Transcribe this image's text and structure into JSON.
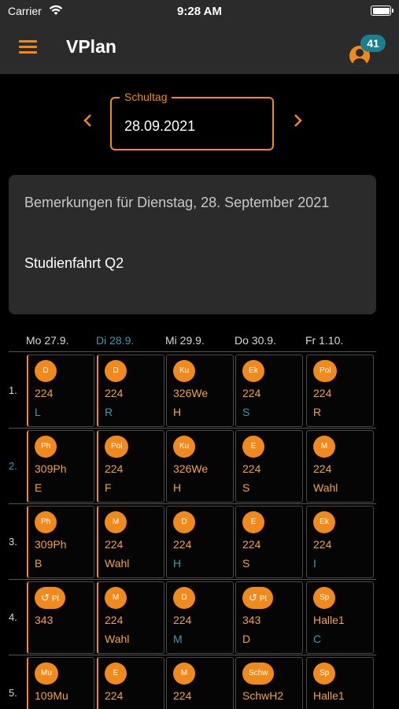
{
  "status": {
    "carrier": "Carrier",
    "time": "9:28 AM"
  },
  "appbar": {
    "title": "VPlan",
    "badge": "41"
  },
  "date": {
    "label": "Schultag",
    "value": "28.09.2021"
  },
  "remarks": {
    "title": "Bemerkungen für Dienstag, 28. September 2021",
    "text": "Studienfahrt Q2"
  },
  "days": [
    "Mo 27.9.",
    "Di 28.9.",
    "Mi 29.9.",
    "Do 30.9.",
    "Fr 1.10."
  ],
  "periods": [
    "1.",
    "2.",
    "3.",
    "4.",
    "5."
  ],
  "rows": [
    [
      {
        "subject": "D",
        "room": "224",
        "teacher": "L",
        "tc": "blue"
      },
      {
        "subject": "D",
        "room": "224",
        "teacher": "R",
        "tc": "blue"
      },
      {
        "subject": "Ku",
        "room": "326We",
        "teacher": "H",
        "tc": "orange"
      },
      {
        "subject": "Ek",
        "room": "224",
        "teacher": "S",
        "tc": "blue"
      },
      {
        "subject": "Pol",
        "room": "224",
        "teacher": "R",
        "tc": "orange"
      }
    ],
    [
      {
        "subject": "Ph",
        "room": "309Ph",
        "teacher": "E",
        "tc": "orange"
      },
      {
        "subject": "Pol",
        "room": "224",
        "teacher": "F",
        "tc": "orange"
      },
      {
        "subject": "Ku",
        "room": "326We",
        "teacher": "H",
        "tc": "orange"
      },
      {
        "subject": "E",
        "room": "224",
        "teacher": "S",
        "tc": "orange"
      },
      {
        "subject": "M",
        "room": "224",
        "teacher": "Wahl",
        "tc": "orange"
      }
    ],
    [
      {
        "subject": "Ph",
        "room": "309Ph",
        "teacher": "B",
        "tc": "orange"
      },
      {
        "subject": "M",
        "room": "224",
        "teacher": "Wahl",
        "tc": "orange"
      },
      {
        "subject": "D",
        "room": "224",
        "teacher": "H",
        "tc": "blue"
      },
      {
        "subject": "E",
        "room": "224",
        "teacher": "S",
        "tc": "orange"
      },
      {
        "subject": "Ek",
        "room": "224",
        "teacher": "I",
        "tc": "blue"
      }
    ],
    [
      {
        "subject": "Pl",
        "icon": "↺",
        "room": "343",
        "teacher": "",
        "tc": "orange"
      },
      {
        "subject": "M",
        "room": "224",
        "teacher": "Wahl",
        "tc": "orange"
      },
      {
        "subject": "D",
        "room": "224",
        "teacher": "M",
        "tc": "blue"
      },
      {
        "subject": "Pl",
        "icon": "↺",
        "room": "343",
        "teacher": "D",
        "tc": "orange"
      },
      {
        "subject": "Sp",
        "room": "Halle1",
        "teacher": "C",
        "tc": "blue"
      }
    ],
    [
      {
        "subject": "Mu",
        "room": "109Mu",
        "teacher": "",
        "tc": "orange"
      },
      {
        "subject": "E",
        "room": "224",
        "teacher": "",
        "tc": "orange"
      },
      {
        "subject": "M",
        "room": "224",
        "teacher": "",
        "tc": "orange"
      },
      {
        "subject": "Schw",
        "room": "SchwH2",
        "teacher": "",
        "tc": "orange"
      },
      {
        "subject": "Sp",
        "room": "Halle1",
        "teacher": "",
        "tc": "orange"
      }
    ]
  ],
  "colors": {
    "accent": "#f08a1c",
    "today": "#3a9ab0",
    "badge": "#1a7f8e",
    "surface": "#2b2b2b"
  },
  "icons": {
    "menu": "hamburger-icon",
    "account": "account-icon",
    "prev": "chevron-left-icon",
    "next": "chevron-right-icon",
    "substitution": "undo-arrow-icon"
  }
}
